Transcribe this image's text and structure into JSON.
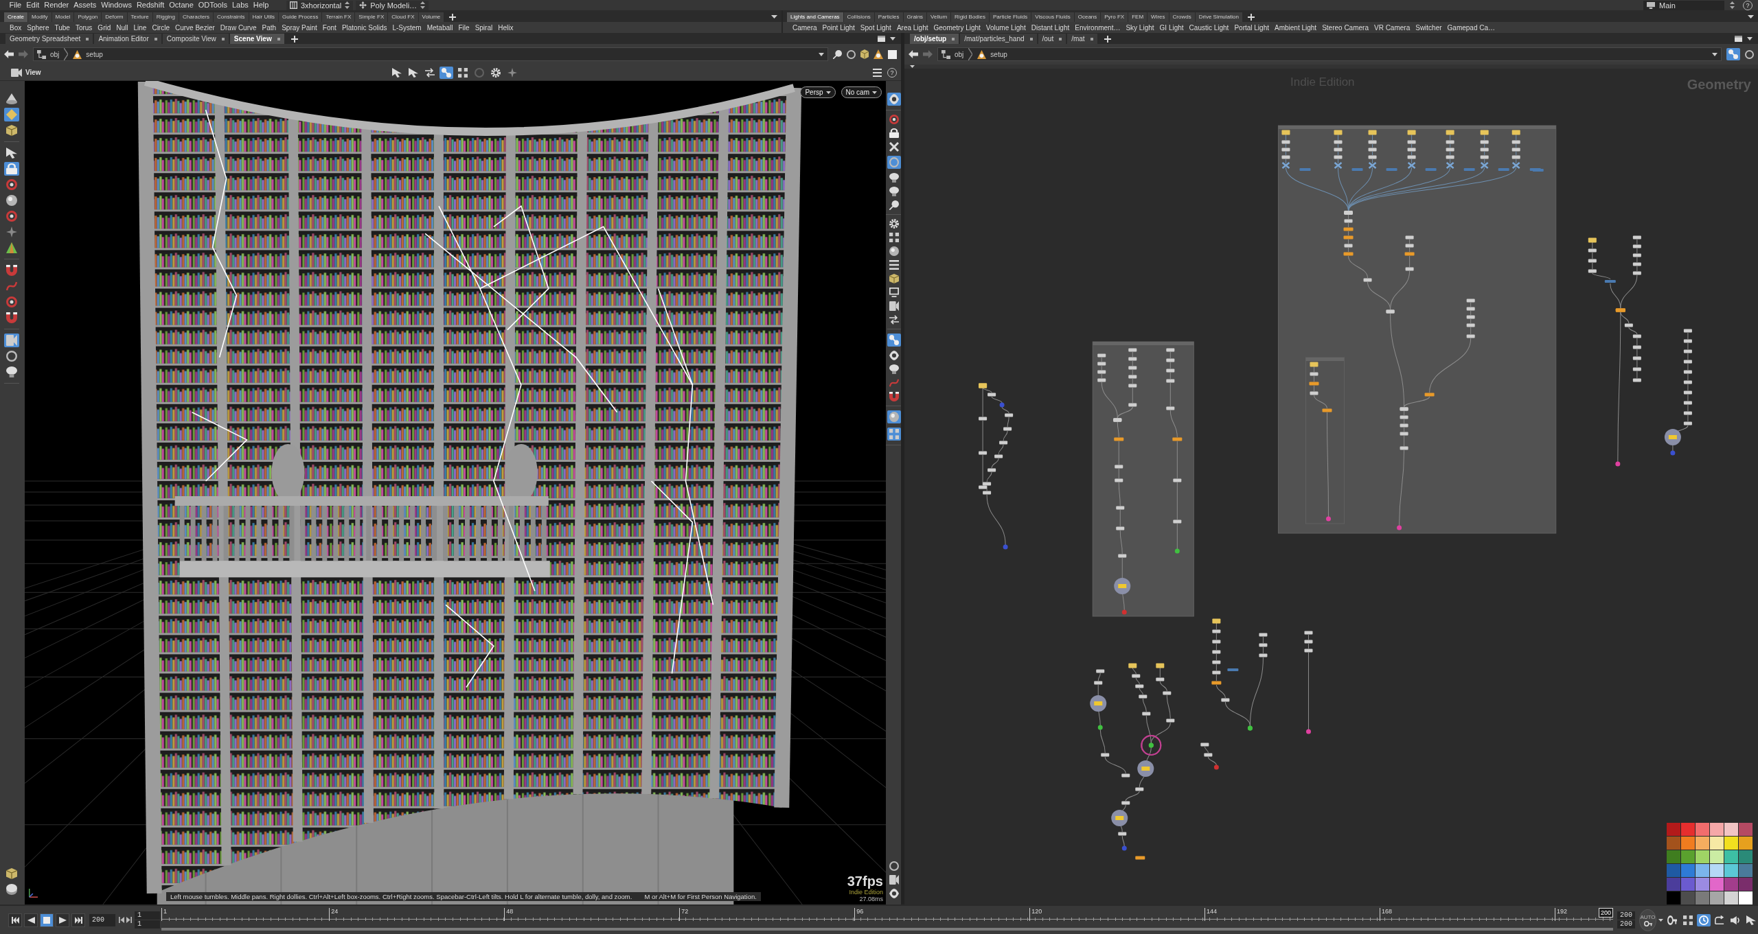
{
  "menu_bar": {
    "items": [
      "File",
      "Edit",
      "Render",
      "Assets",
      "Windows",
      "Redshift",
      "Octane",
      "ODTools",
      "Labs",
      "Help"
    ],
    "desktop_layout": "3xhorizontal",
    "shelf_menu": "Poly Modeli…",
    "desktop": "Main",
    "help": "?"
  },
  "shelf_sets": [
    {
      "tabs": [
        {
          "label": "Create",
          "selected": true
        },
        {
          "label": "Modify",
          "selected": false
        },
        {
          "label": "Model",
          "selected": false
        },
        {
          "label": "Polygon",
          "selected": false
        },
        {
          "label": "Deform",
          "selected": false
        },
        {
          "label": "Texture",
          "selected": false
        },
        {
          "label": "Rigging",
          "selected": false
        },
        {
          "label": "Characters",
          "selected": false
        },
        {
          "label": "Constraints",
          "selected": false
        },
        {
          "label": "Hair Utils",
          "selected": false
        },
        {
          "label": "Guide Process",
          "selected": false
        },
        {
          "label": "Terrain FX",
          "selected": false
        },
        {
          "label": "Simple FX",
          "selected": false
        },
        {
          "label": "Cloud FX",
          "selected": false
        },
        {
          "label": "Volume",
          "selected": false
        }
      ],
      "tools": [
        "Box",
        "Sphere",
        "Tube",
        "Torus",
        "Grid",
        "Null",
        "Line",
        "Circle",
        "Curve Bezier",
        "Draw Curve",
        "Path",
        "Spray Paint",
        "Font",
        "Platonic Solids",
        "L-System",
        "Metaball",
        "File",
        "Spiral",
        "Helix"
      ]
    },
    {
      "tabs": [
        {
          "label": "Lights and Cameras",
          "selected": true
        },
        {
          "label": "Collisions",
          "selected": false
        },
        {
          "label": "Particles",
          "selected": false
        },
        {
          "label": "Grains",
          "selected": false
        },
        {
          "label": "Vellum",
          "selected": false
        },
        {
          "label": "Rigid Bodies",
          "selected": false
        },
        {
          "label": "Particle Fluids",
          "selected": false
        },
        {
          "label": "Viscous Fluids",
          "selected": false
        },
        {
          "label": "Oceans",
          "selected": false
        },
        {
          "label": "Pyro FX",
          "selected": false
        },
        {
          "label": "FEM",
          "selected": false
        },
        {
          "label": "Wires",
          "selected": false
        },
        {
          "label": "Crowds",
          "selected": false
        },
        {
          "label": "Drive Simulation",
          "selected": false
        }
      ],
      "tools": [
        "Camera",
        "Point Light",
        "Spot Light",
        "Area Light",
        "Geometry Light",
        "Volume Light",
        "Distant Light",
        "Environment…",
        "Sky Light",
        "GI Light",
        "Caustic Light",
        "Portal Light",
        "Ambient Light",
        "Stereo Camera",
        "VR Camera",
        "Switcher",
        "Gamepad Ca…"
      ]
    }
  ],
  "scene_pane": {
    "tabs": [
      {
        "label": "Geometry Spreadsheet",
        "selected": false
      },
      {
        "label": "Animation Editor",
        "selected": false
      },
      {
        "label": "Composite View",
        "selected": false
      },
      {
        "label": "Scene View",
        "selected": true
      }
    ],
    "path": [
      "obj",
      "setup"
    ],
    "viewport": {
      "title": "View",
      "header_tools": [
        {
          "kind": "arrow",
          "selected": false,
          "disabled": false
        },
        {
          "kind": "arrow",
          "selected": false,
          "disabled": false
        },
        {
          "kind": "swap",
          "selected": false,
          "disabled": false
        },
        {
          "kind": "snap",
          "selected": true,
          "disabled": false
        },
        {
          "kind": "dots",
          "selected": false,
          "disabled": false
        },
        {
          "kind": "ring",
          "selected": false,
          "disabled": true
        },
        {
          "kind": "gear",
          "selected": false,
          "disabled": false
        },
        {
          "kind": "sparkle",
          "selected": false,
          "disabled": false
        }
      ],
      "help": "?",
      "left_tool_groups": [
        [
          {
            "kind": "cone",
            "selected": false
          },
          {
            "kind": "diamond",
            "selected": true
          },
          {
            "kind": "cube",
            "selected": false
          }
        ],
        [
          {
            "kind": "arrow",
            "selected": false
          },
          {
            "kind": "lock",
            "selected": true
          },
          {
            "kind": "handle",
            "selected": false
          },
          {
            "kind": "sphere",
            "selected": false
          },
          {
            "kind": "handle",
            "selected": false
          },
          {
            "kind": "sparkle",
            "selected": false
          },
          {
            "kind": "triangle",
            "selected": false
          }
        ],
        [
          {
            "kind": "magnet",
            "selected": false
          },
          {
            "kind": "curve",
            "selected": false
          },
          {
            "kind": "handle",
            "selected": false
          },
          {
            "kind": "magnet",
            "selected": false
          }
        ],
        [
          {
            "kind": "camera",
            "selected": true
          },
          {
            "kind": "ring",
            "selected": false
          },
          {
            "kind": "bulb",
            "selected": false
          }
        ]
      ],
      "left_tools_bottom": [
        {
          "kind": "cube",
          "selected": false
        },
        {
          "kind": "disk",
          "selected": false
        }
      ],
      "right_tool_groups": [
        [
          {
            "kind": "eye",
            "selected": true
          }
        ],
        [
          {
            "kind": "handle",
            "selected": false
          },
          {
            "kind": "lock",
            "selected": false
          },
          {
            "kind": "cross",
            "selected": false
          },
          {
            "kind": "ring",
            "selected": true
          },
          {
            "kind": "bulb",
            "selected": false
          },
          {
            "kind": "bulb",
            "selected": false
          },
          {
            "kind": "pin",
            "selected": false
          }
        ],
        [
          {
            "kind": "gear",
            "selected": false
          },
          {
            "kind": "dots",
            "selected": false
          },
          {
            "kind": "sphere",
            "selected": false
          },
          {
            "kind": "lines",
            "selected": false
          },
          {
            "kind": "cube",
            "selected": false
          },
          {
            "kind": "monitor",
            "selected": false
          },
          {
            "kind": "camera",
            "selected": false
          },
          {
            "kind": "swap",
            "selected": false
          }
        ],
        [
          {
            "kind": "snap",
            "selected": true
          },
          {
            "kind": "eye",
            "selected": false
          },
          {
            "kind": "bulb",
            "selected": false
          },
          {
            "kind": "curve",
            "selected": false
          },
          {
            "kind": "magnet",
            "selected": false
          }
        ],
        [
          {
            "kind": "sphere",
            "selected": true
          },
          {
            "kind": "dots",
            "selected": true
          }
        ]
      ],
      "right_tools_bottom": [
        {
          "kind": "ring",
          "selected": false
        },
        {
          "kind": "camera",
          "selected": false
        },
        {
          "kind": "eye",
          "selected": false
        }
      ],
      "camera": "Persp",
      "camera_menu": "No cam",
      "fps": "37fps",
      "edition": "Indie Edition",
      "frame_time": "27.08ms",
      "hint": [
        "Left mouse tumbles. Middle pans. Right dollies. Ctrl+Alt+Left box-zooms. Ctrl+Right zooms. Spacebar-Ctrl-Left tilts. Hold L for alternate tumble, dolly, and zoom.",
        "M or Alt+M for First Person Navigation."
      ]
    }
  },
  "network_pane": {
    "tabs": [
      {
        "label": "/obj/setup",
        "selected": true
      },
      {
        "label": "/mat/particles_hand",
        "selected": false
      },
      {
        "label": "/out",
        "selected": false
      },
      {
        "label": "/mat",
        "selected": false
      }
    ],
    "path": [
      "obj",
      "setup"
    ],
    "edition": "Indie Edition",
    "context": "Geometry",
    "palette": [
      {
        "color": "#b31a1a"
      },
      {
        "color": "#e62e2e"
      },
      {
        "color": "#f26d6d"
      },
      {
        "color": "#f5a8a8"
      },
      {
        "color": "#f2c4c4"
      },
      {
        "color": "#b54a63"
      },
      {
        "color": "#a3521c"
      },
      {
        "color": "#f07c1f"
      },
      {
        "color": "#f5ad5f"
      },
      {
        "color": "#f7e9a4"
      },
      {
        "color": "#f2df1f"
      },
      {
        "color": "#e6a01e"
      },
      {
        "color": "#3f7d1f"
      },
      {
        "color": "#5aa12e"
      },
      {
        "color": "#9fd465"
      },
      {
        "color": "#cbeca3"
      },
      {
        "color": "#3dbfa4"
      },
      {
        "color": "#2a8a78"
      },
      {
        "color": "#1f5aa3"
      },
      {
        "color": "#2e7bd6"
      },
      {
        "color": "#7bb5ec"
      },
      {
        "color": "#b5d9f6"
      },
      {
        "color": "#5bc8d6"
      },
      {
        "color": "#4a7b9b"
      },
      {
        "color": "#4b3d9b"
      },
      {
        "color": "#6b5bcf"
      },
      {
        "color": "#9b8be2"
      },
      {
        "color": "#e267c9"
      },
      {
        "color": "#a33d8c"
      },
      {
        "color": "#7a2d6b"
      },
      {
        "color": "#000000"
      },
      {
        "color": "#4d4d4d"
      },
      {
        "color": "#7a7a7a"
      },
      {
        "color": "#a6a6a6"
      },
      {
        "color": "#d4d4d4"
      },
      {
        "color": "#ffffff"
      }
    ]
  },
  "timeline": {
    "transport": [
      {
        "kind": "first",
        "selected": false
      },
      {
        "kind": "prev",
        "selected": false
      },
      {
        "kind": "stop",
        "selected": true
      },
      {
        "kind": "play",
        "selected": false
      },
      {
        "kind": "last",
        "selected": false
      }
    ],
    "frame": "200",
    "range_start": [
      "1",
      "1"
    ],
    "ticks": [
      "1",
      "24",
      "48",
      "72",
      "96",
      "120",
      "144",
      "168",
      "192"
    ],
    "playhead": {
      "label": "200",
      "level": 1
    },
    "range_end": [
      "200",
      "200"
    ],
    "auto_key": "AUTO",
    "tools": [
      {
        "kind": "key",
        "selected": false
      },
      {
        "kind": "dots",
        "selected": false
      },
      {
        "kind": "clock",
        "selected": true
      },
      {
        "kind": "loop",
        "selected": false
      },
      {
        "kind": "sound",
        "selected": false
      },
      {
        "kind": "arrow",
        "selected": false
      }
    ]
  }
}
